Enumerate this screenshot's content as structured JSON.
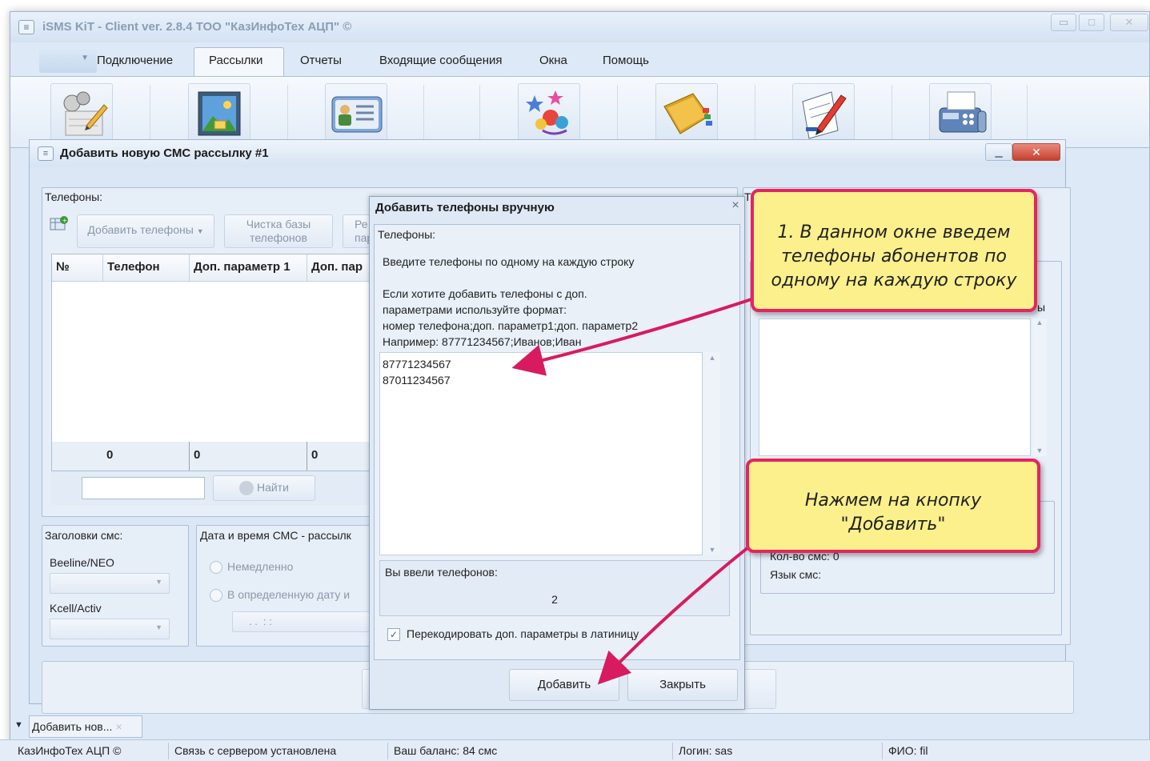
{
  "window": {
    "title": "iSMS KiT - Client ver. 2.8.4 ТОО \"КазИнфоТех АЦП\" ©"
  },
  "menu": {
    "items": [
      "Подключение",
      "Рассылки",
      "Отчеты",
      "Входящие сообщения",
      "Окна",
      "Помощь"
    ],
    "active": "Рассылки"
  },
  "ribbon": {
    "icons": [
      "compose-sms-icon",
      "image-icon",
      "contact-card-icon",
      "celebration-icon",
      "address-book-icon",
      "edit-document-icon",
      "fax-machine-icon"
    ]
  },
  "child_window": {
    "title": "Добавить новую СМС рассылку #1",
    "phones_group": {
      "label": "Телефоны:",
      "add_phones_button": "Добавить телефоны",
      "clean_db_button": "Чистка базы телефонов",
      "partial_button": "Ре пар",
      "columns": [
        "№",
        "Телефон",
        "Доп. параметр 1",
        "Доп. пар"
      ],
      "footer": [
        "0",
        "0",
        "0"
      ],
      "search_placeholder": "",
      "find_button": "Найти"
    },
    "headers_group": {
      "label": "Заголовки смс:",
      "operators": [
        "Beeline/NEO",
        "Kcell/Activ"
      ]
    },
    "datetime_group": {
      "label": "Дата и время СМС - рассылк",
      "options": [
        "Немедленно",
        "В определенную дату и"
      ],
      "datetime_value": ". .  : :"
    },
    "right_panel": {
      "label_t": "Т",
      "label_suffix": "ы",
      "sms_count": "Кол-во смс: 0",
      "sms_language": "Язык смс:"
    }
  },
  "dialog": {
    "title": "Добавить телефоны вручную",
    "group_label": "Телефоны:",
    "instruction1": "Введите телефоны по одному на каждую строку",
    "instruction2_lines": [
      "Если хотите добавить телефоны с доп.",
      "параметрами используйте формат:",
      "номер телефона;доп. параметр1;доп. параметр2",
      "Например: 87771234567;Иванов;Иван"
    ],
    "phones": [
      "87771234567",
      "87011234567"
    ],
    "count_label": "Вы ввели телефонов:",
    "count_value": "2",
    "transcode_label": "Перекодировать доп. параметры в латиницу",
    "transcode_checked": true,
    "add_button": "Добавить",
    "close_button": "Закрыть"
  },
  "callouts": {
    "first": "1. В данном окне введем телефоны абонентов по одному на каждую строку",
    "second": "Нажмем на кнопку \"Добавить\""
  },
  "taskbar": {
    "tab_label": "Добавить нов..."
  },
  "statusbar": {
    "company": "КазИнфоТех АЦП ©",
    "connection": "Связь с сервером установлена",
    "balance": "Ваш баланс: 84 смс",
    "login": "Логин: sas",
    "fio": "ФИО: fil"
  },
  "colors": {
    "callout_fill": "#fbf08b",
    "callout_border": "#e62460",
    "arrow": "#d81b60",
    "child_close": "#c7402e"
  }
}
